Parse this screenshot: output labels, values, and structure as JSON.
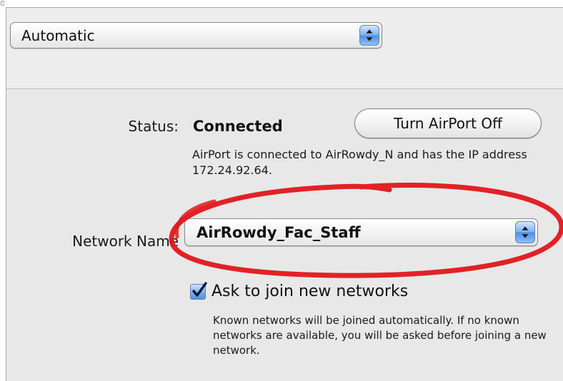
{
  "location": {
    "selected": "Automatic"
  },
  "status": {
    "label": "Status:",
    "value": "Connected",
    "button_label": "Turn AirPort Off",
    "description": "AirPort is connected to AirRowdy_N and has the IP address 172.24.92.64."
  },
  "network": {
    "label": "Network Name",
    "selected": "AirRowdy_Fac_Staff"
  },
  "ask_join": {
    "label": "Ask to join new networks",
    "checked": true,
    "description": "Known networks will be joined automatically. If no known networks are available, you will be asked before joining a new network."
  },
  "annotation": {
    "color": "#e0171c"
  },
  "colors": {
    "panel_bg": "#e8e8e8",
    "popup_accent": "#4f8ee3"
  },
  "icons": {
    "popup_arrows": "up-down-chevron-icon",
    "checkbox": "checkmark-icon"
  }
}
